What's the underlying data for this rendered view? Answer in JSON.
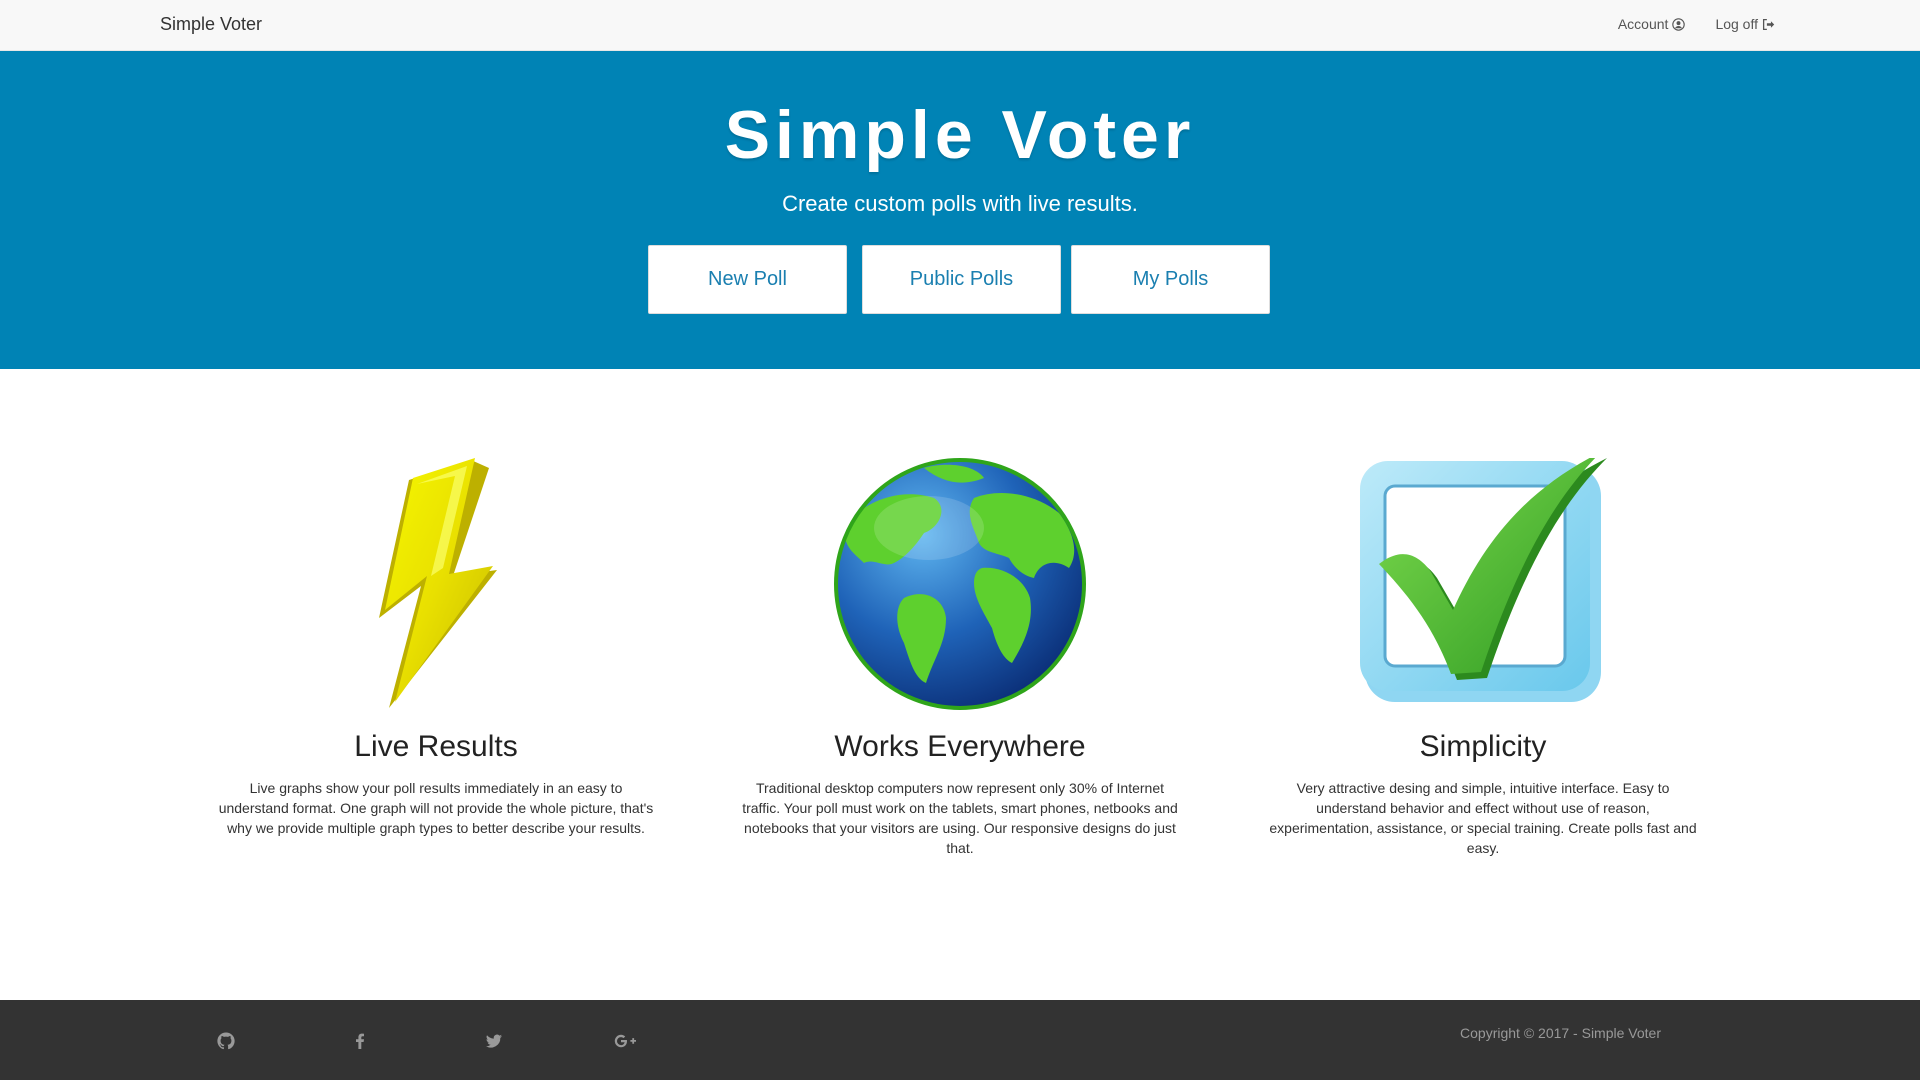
{
  "navbar": {
    "brand": "Simple Voter",
    "account_label": "Account",
    "logoff_label": "Log off"
  },
  "hero": {
    "title": "Simple Voter",
    "subtitle": "Create custom polls with live results.",
    "buttons": [
      "New Poll",
      "Public Polls",
      "My Polls"
    ]
  },
  "features": [
    {
      "icon": "lightning-icon",
      "title": "Live Results",
      "text": "Live graphs show your poll results immediately in an easy to understand format. One graph will not provide the whole picture, that's why we provide multiple graph types to better describe your results."
    },
    {
      "icon": "globe-icon",
      "title": "Works Everywhere",
      "text": "Traditional desktop computers now represent only 30% of Internet traffic. Your poll must work on the tablets, smart phones, netbooks and notebooks that your visitors are using. Our responsive designs do just that."
    },
    {
      "icon": "checkbox-icon",
      "title": "Simplicity",
      "text": "Very attractive desing and simple, intuitive interface. Easy to understand behavior and effect without use of reason, experimentation, assistance, or special training. Create polls fast and easy."
    }
  ],
  "footer": {
    "social": [
      "github-icon",
      "facebook-icon",
      "twitter-icon",
      "google-plus-icon"
    ],
    "copyright": "Copyright © 2017 - Simple Voter"
  },
  "colors": {
    "hero_bg": "#0083b5",
    "button_text": "#1a7fb0",
    "footer_bg": "#333333"
  }
}
